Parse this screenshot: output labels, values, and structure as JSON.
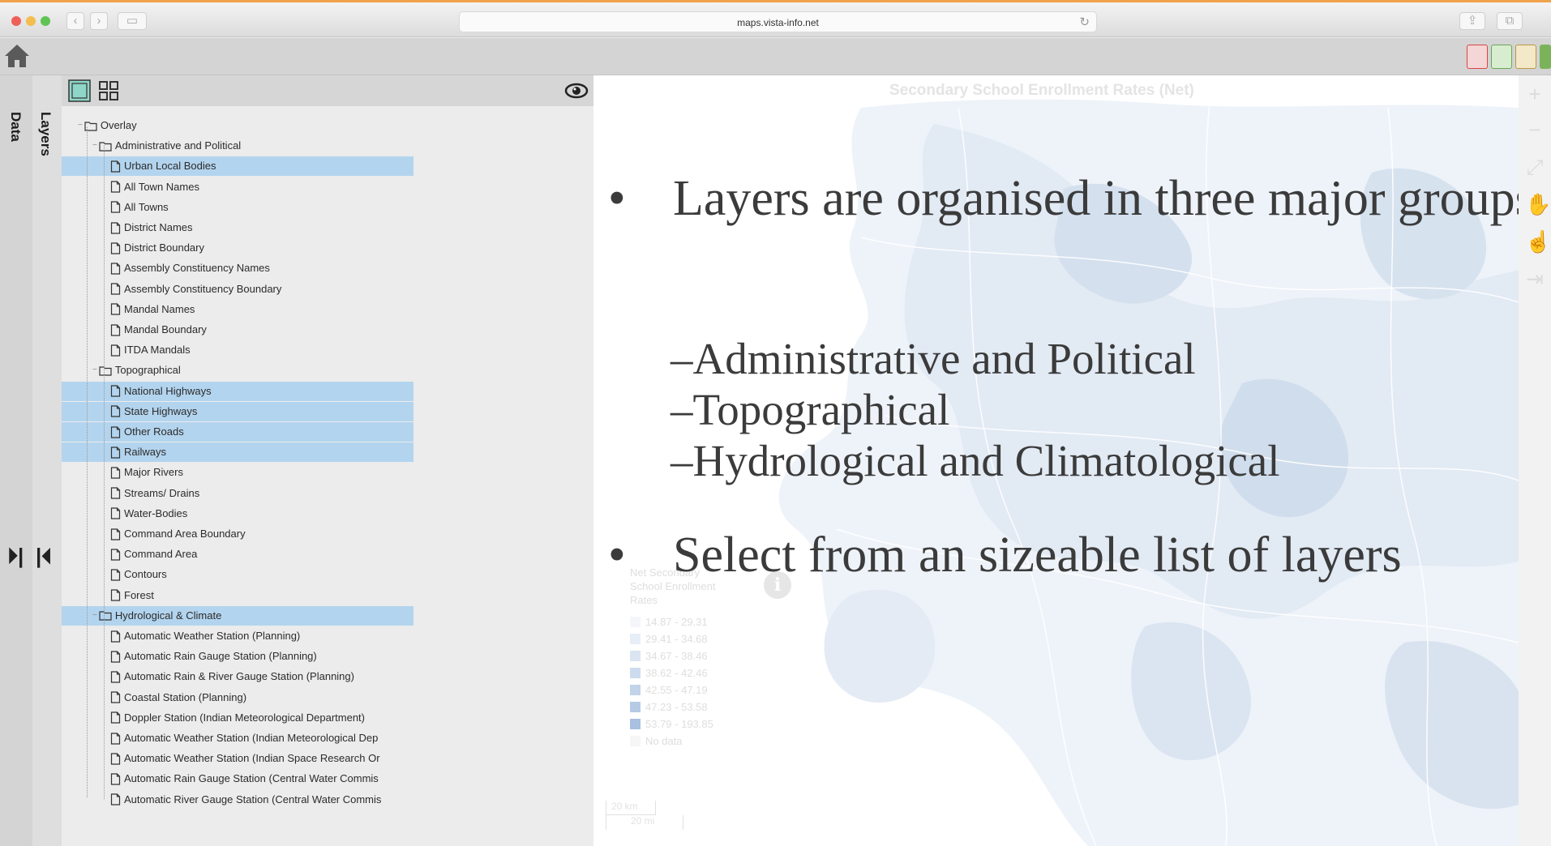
{
  "browser": {
    "url": "maps.vista-info.net",
    "accent_color": "#f0a24a"
  },
  "left_tabs": {
    "data_label": "Data",
    "layers_label": "Layers"
  },
  "tree": {
    "root": "Overlay",
    "groups": [
      {
        "label": "Administrative and Political",
        "items": [
          {
            "label": "Urban Local Bodies",
            "selected": true
          },
          {
            "label": "All Town Names",
            "selected": false
          },
          {
            "label": "All Towns",
            "selected": false
          },
          {
            "label": "District Names",
            "selected": false
          },
          {
            "label": "District Boundary",
            "selected": false
          },
          {
            "label": "Assembly Constituency Names",
            "selected": false
          },
          {
            "label": "Assembly Constituency Boundary",
            "selected": false
          },
          {
            "label": "Mandal Names",
            "selected": false
          },
          {
            "label": "Mandal Boundary",
            "selected": false
          },
          {
            "label": "ITDA Mandals",
            "selected": false
          }
        ]
      },
      {
        "label": "Topographical",
        "items": [
          {
            "label": "National Highways",
            "selected": true
          },
          {
            "label": "State Highways",
            "selected": true
          },
          {
            "label": "Other Roads",
            "selected": true
          },
          {
            "label": "Railways",
            "selected": true
          },
          {
            "label": "Major Rivers",
            "selected": false
          },
          {
            "label": "Streams/ Drains",
            "selected": false
          },
          {
            "label": "Water-Bodies",
            "selected": false
          },
          {
            "label": "Command Area Boundary",
            "selected": false
          },
          {
            "label": "Command Area",
            "selected": false
          },
          {
            "label": "Contours",
            "selected": false
          },
          {
            "label": "Forest",
            "selected": false
          }
        ]
      },
      {
        "label": "Hydrological & Climate",
        "selected": true,
        "items": [
          {
            "label": "Automatic Weather Station (Planning)",
            "selected": false
          },
          {
            "label": "Automatic Rain Gauge Station (Planning)",
            "selected": false
          },
          {
            "label": "Automatic Rain & River Gauge Station (Planning)",
            "selected": false
          },
          {
            "label": "Coastal Station (Planning)",
            "selected": false
          },
          {
            "label": "Doppler Station (Indian Meteorological Department)",
            "selected": false
          },
          {
            "label": "Automatic Weather Station (Indian Meteorological Dep",
            "selected": false
          },
          {
            "label": "Automatic Weather Station (Indian Space Research Or",
            "selected": false
          },
          {
            "label": "Automatic Rain Gauge Station (Central Water Commis",
            "selected": false
          },
          {
            "label": "Automatic River Gauge Station (Central Water Commis",
            "selected": false
          }
        ]
      }
    ]
  },
  "map": {
    "title": "Secondary School Enrollment Rates (Net)",
    "legend": {
      "title_lines": [
        "Net Secondary",
        "School Enrollment",
        "Rates"
      ],
      "entries": [
        {
          "label": "14.87 - 29.31",
          "color": "#f4f6fa"
        },
        {
          "label": "29.41 - 34.68",
          "color": "#e8eef7"
        },
        {
          "label": "34.67 - 38.46",
          "color": "#dbe5f2"
        },
        {
          "label": "38.62 - 42.46",
          "color": "#cddbee"
        },
        {
          "label": "42.55 - 47.19",
          "color": "#c2d3ea"
        },
        {
          "label": "47.23 - 53.58",
          "color": "#b6cae5"
        },
        {
          "label": "53.79 - 193.85",
          "color": "#a9c0e0"
        },
        {
          "label": "No data",
          "color": "#f6f6f6"
        }
      ]
    },
    "scale": {
      "km": "20 km",
      "mi": "20 mi"
    }
  },
  "slide": {
    "bullet1": "Layers are organised in three major groups",
    "subs": [
      "Administrative and Political",
      "Topographical",
      "Hydrological and Climatological"
    ],
    "bullet2": "Select from an sizeable list of layers"
  }
}
